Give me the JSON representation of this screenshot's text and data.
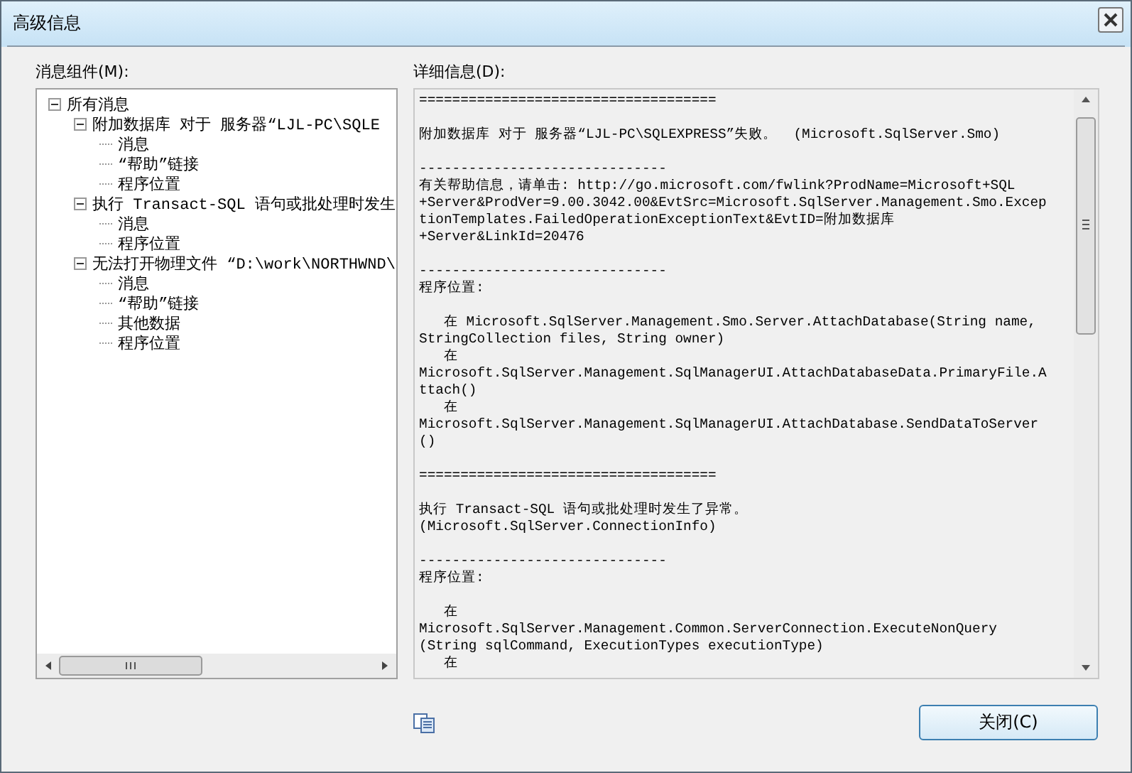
{
  "window": {
    "title": "高级信息"
  },
  "tree": {
    "label": "消息组件(M):",
    "items": [
      {
        "label": "所有消息",
        "expanded": true,
        "children": [
          {
            "label": "附加数据库 对于 服务器“LJL-PC\\SQLE",
            "expanded": true,
            "children": [
              {
                "label": "消息"
              },
              {
                "label": "“帮助”链接"
              },
              {
                "label": "程序位置"
              }
            ]
          },
          {
            "label": "执行 Transact-SQL 语句或批处理时发生",
            "expanded": true,
            "children": [
              {
                "label": "消息"
              },
              {
                "label": "程序位置"
              }
            ]
          },
          {
            "label": "无法打开物理文件 “D:\\work\\NORTHWND\\",
            "expanded": true,
            "children": [
              {
                "label": "消息"
              },
              {
                "label": "“帮助”链接"
              },
              {
                "label": "其他数据"
              },
              {
                "label": "程序位置"
              }
            ]
          }
        ]
      }
    ]
  },
  "detail": {
    "label": "详细信息(D):",
    "blocks": [
      {
        "lines": [
          "===================================="
        ]
      },
      {
        "lines": [
          "附加数据库 对于 服务器“LJL-PC\\SQLEXPRESS”失败。  (Microsoft.SqlServer.Smo)"
        ]
      },
      {
        "lines": [
          "------------------------------",
          "有关帮助信息，请单击: http://go.microsoft.com/fwlink?ProdName=Microsoft+SQL",
          "+Server&ProdVer=9.00.3042.00&EvtSrc=Microsoft.SqlServer.Management.Smo.Excep",
          "tionTemplates.FailedOperationExceptionText&EvtID=附加数据库",
          "+Server&LinkId=20476"
        ]
      },
      {
        "lines": [
          "------------------------------",
          "程序位置:"
        ]
      },
      {
        "lines": [
          "   在 Microsoft.SqlServer.Management.Smo.Server.AttachDatabase(String name,",
          "StringCollection files, String owner)",
          "   在",
          "Microsoft.SqlServer.Management.SqlManagerUI.AttachDatabaseData.PrimaryFile.A",
          "ttach()",
          "   在",
          "Microsoft.SqlServer.Management.SqlManagerUI.AttachDatabase.SendDataToServer",
          "()"
        ]
      },
      {
        "lines": [
          "===================================="
        ]
      },
      {
        "lines": [
          "执行 Transact-SQL 语句或批处理时发生了异常。",
          "(Microsoft.SqlServer.ConnectionInfo)"
        ]
      },
      {
        "lines": [
          "------------------------------",
          "程序位置:"
        ]
      },
      {
        "lines": [
          "   在",
          "Microsoft.SqlServer.Management.Common.ServerConnection.ExecuteNonQuery",
          "(String sqlCommand, ExecutionTypes executionType)",
          "   在"
        ]
      }
    ]
  },
  "buttons": {
    "close": "关闭(C)"
  }
}
